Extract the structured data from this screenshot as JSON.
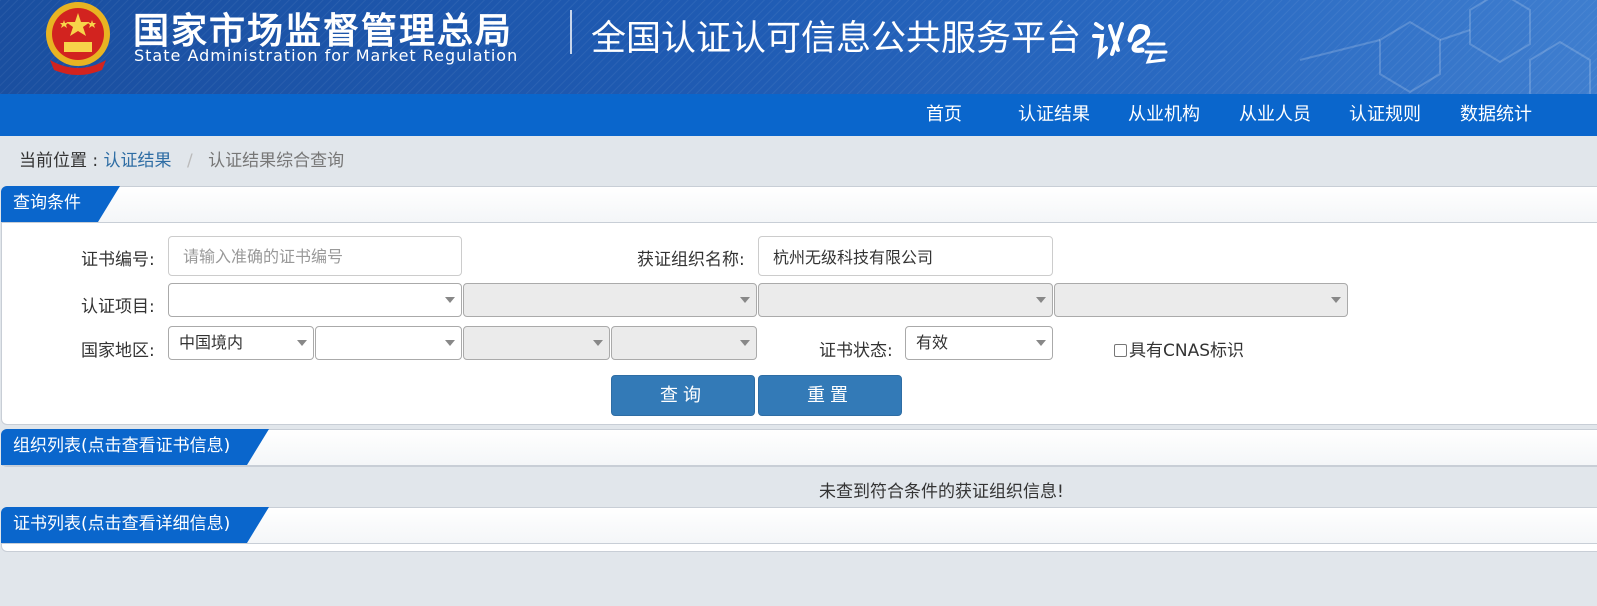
{
  "header": {
    "cn_title": "国家市场监督管理总局",
    "en_title": "State Administration  for  Market Regulation",
    "platform_name": "全国认证认可信息公共服务平台",
    "logo_mark": "认e云"
  },
  "nav": [
    "首页",
    "认证结果",
    "从业机构",
    "从业人员",
    "认证规则",
    "数据统计"
  ],
  "breadcrumb": {
    "label": "当前位置 :",
    "parent": "认证结果",
    "separator": "/",
    "current": "认证结果综合查询"
  },
  "query_panel": {
    "title": "查询条件",
    "cert_no_label": "证书编号:",
    "cert_no_placeholder": "请输入准确的证书编号",
    "cert_no_value": "",
    "org_name_label": "获证组织名称:",
    "org_name_value": "杭州无级科技有限公司",
    "project_label": "认证项目:",
    "project_selects": [
      "",
      "",
      "",
      ""
    ],
    "region_label": "国家地区:",
    "region_selects": [
      "中国境内",
      "",
      "",
      ""
    ],
    "status_label": "证书状态:",
    "status_value": "有效",
    "cnas_label": "具有CNAS标识",
    "cnas_checked": false,
    "search_button": "查询",
    "reset_button": "重置"
  },
  "org_panel": {
    "title": "组织列表(点击查看证书信息)",
    "empty_message": "未查到符合条件的获证组织信息!"
  },
  "cert_panel": {
    "title": "证书列表(点击查看详细信息)"
  },
  "colors": {
    "header_blue": "#1f5bb3",
    "nav_blue": "#0a66cc",
    "button_blue": "#337ab7",
    "link_blue": "#2e6da4",
    "background": "#e1e6eb"
  }
}
